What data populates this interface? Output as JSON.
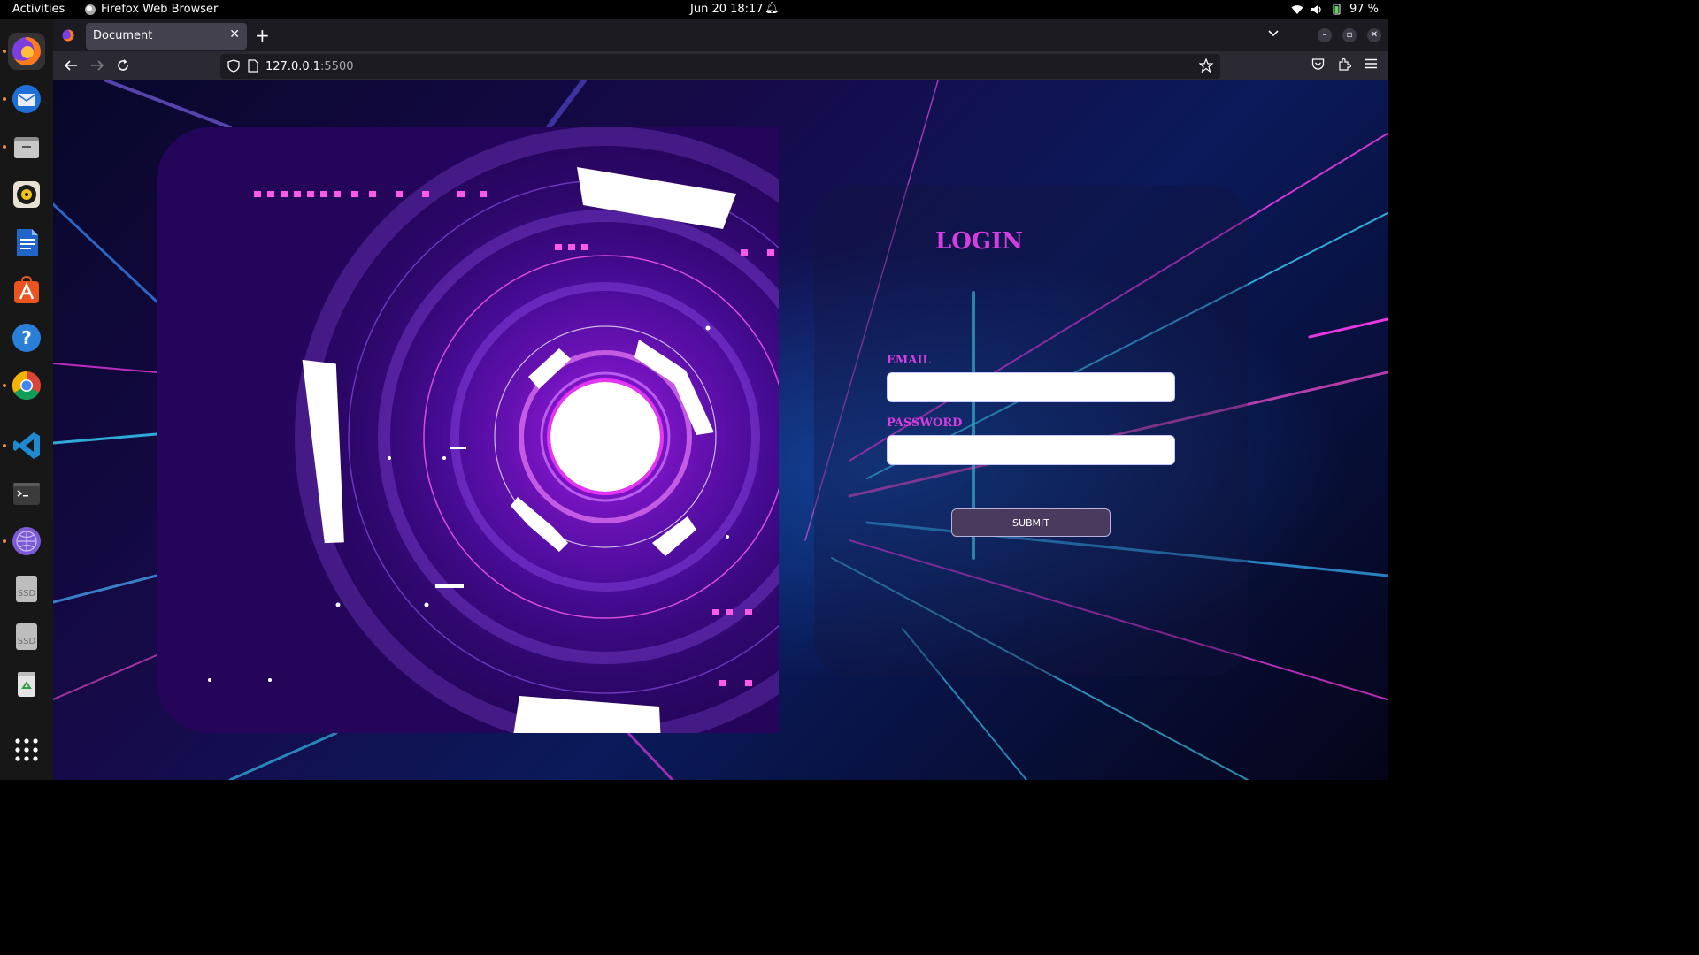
{
  "topbar": {
    "activities": "Activities",
    "app_name": "Firefox Web Browser",
    "datetime": "Jun 20  18:17",
    "battery": "97 %"
  },
  "dock": {
    "items": [
      {
        "name": "firefox",
        "icon": "firefox-icon"
      },
      {
        "name": "thunderbird",
        "icon": "mail-icon"
      },
      {
        "name": "files",
        "icon": "folder-icon"
      },
      {
        "name": "rhythmbox",
        "icon": "music-icon"
      },
      {
        "name": "writer",
        "icon": "document-icon"
      },
      {
        "name": "app-center",
        "icon": "store-icon"
      },
      {
        "name": "help",
        "icon": "help-icon"
      },
      {
        "name": "chrome",
        "icon": "chrome-icon"
      },
      {
        "name": "vscode",
        "icon": "vscode-icon"
      },
      {
        "name": "terminal",
        "icon": "terminal-icon"
      },
      {
        "name": "web-app",
        "icon": "globe-icon"
      },
      {
        "name": "ssd-1",
        "icon": "drive-icon",
        "label": "SSD"
      },
      {
        "name": "ssd-2",
        "icon": "drive-icon",
        "label": "SSD"
      },
      {
        "name": "trash",
        "icon": "trash-icon"
      },
      {
        "name": "show-apps",
        "icon": "grid-icon"
      }
    ]
  },
  "browser": {
    "tab_title": "Document",
    "url_host": "127.0.0.1",
    "url_port": ":5500"
  },
  "login": {
    "title": "LOGIN",
    "email_label": "EMAIL",
    "email_value": "",
    "password_label": "PASSWORD",
    "password_value": "",
    "submit_label": "SUBMIT"
  },
  "colors": {
    "accent": "#d63de0",
    "submit_bg": "#4a3a5e",
    "hero_bg": "#25045e"
  }
}
